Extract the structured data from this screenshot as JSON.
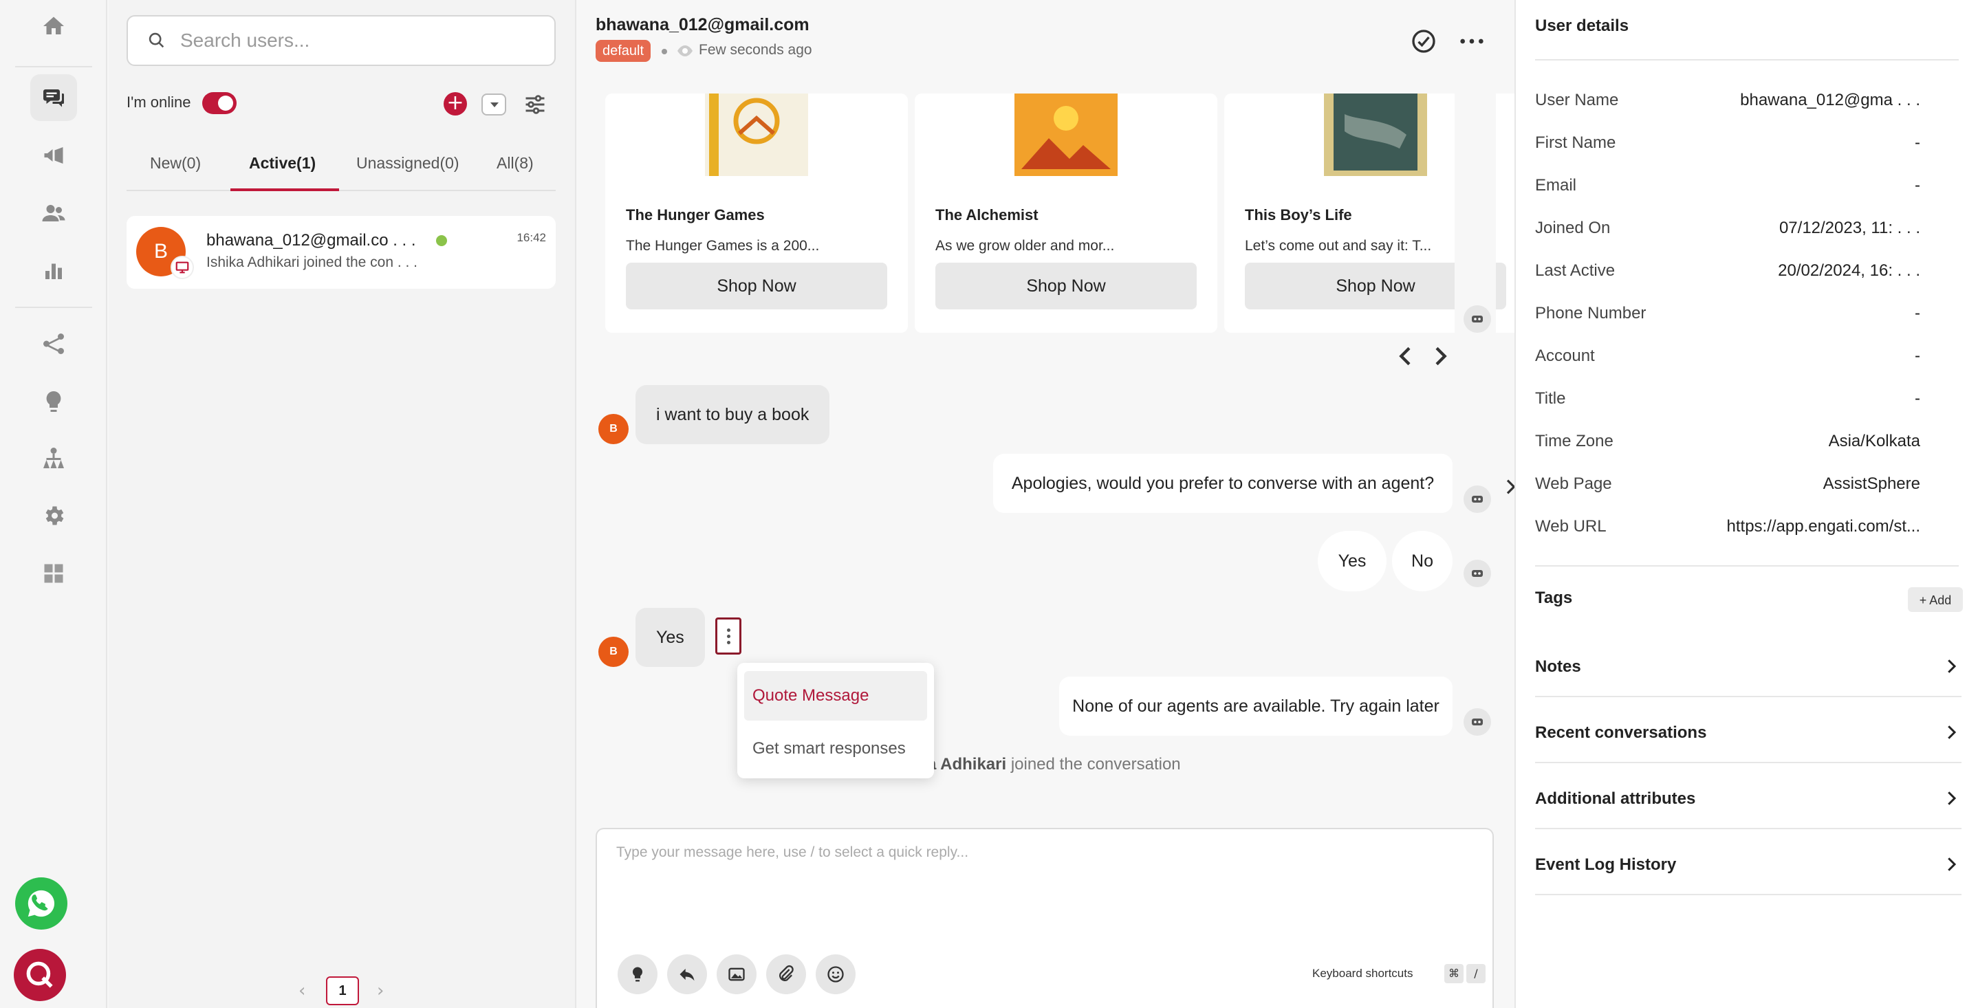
{
  "rail": {
    "icons": [
      "home-icon",
      "chat-icon",
      "megaphone-icon",
      "users-icon",
      "analytics-icon",
      "flow-icon",
      "bulb-icon",
      "org-chart-icon",
      "settings-icon",
      "integrations-icon"
    ],
    "active": "chat-icon"
  },
  "list": {
    "search_placeholder": "Search users...",
    "online_label": "I'm online",
    "tabs": [
      "New(0)",
      "Active(1)",
      "Unassigned(0)",
      "All(8)"
    ],
    "active_tab": "Active(1)",
    "conversation": {
      "avatar_letter": "B",
      "name": "bhawana_012@gmail.co . . .",
      "time": "16:42",
      "preview": "Ishika Adhikari joined the con . . .",
      "online_color": "#8bc34a"
    },
    "pager": {
      "page": "1",
      "prev": "‹",
      "next": "›"
    }
  },
  "chat": {
    "email": "bhawana_012@gmail.com",
    "badge": "default",
    "seen": "Few seconds ago",
    "cards": [
      {
        "title": "The Hunger Games",
        "desc": "The Hunger Games is a 200...",
        "button": "Shop Now"
      },
      {
        "title": "The Alchemist",
        "desc": "As we grow older and mor...",
        "button": "Shop Now"
      },
      {
        "title": "This Boy’s Life",
        "desc": "Let’s come out and say it: T...",
        "button": "Shop Now"
      }
    ],
    "messages": {
      "user_1": "i want to buy a book",
      "bot_1": "Apologies, would you prefer to converse with an agent?",
      "quick_yes": "Yes",
      "quick_no": "No",
      "user_2": "Yes",
      "bot_2": "None of our agents are available. Try again later",
      "user_avatar": "B"
    },
    "system_note_bold": "a Adhikari",
    "system_note": " joined the conversation",
    "context_menu": {
      "quote": "Quote Message",
      "smart": "Get smart responses"
    },
    "composer": {
      "placeholder": "Type your message here, use / to select a quick reply...",
      "shortcuts_label": "Keyboard shortcuts",
      "key1": "⌘",
      "key2": "/"
    }
  },
  "details": {
    "title": "User details",
    "rows": [
      {
        "label": "User Name",
        "value": "bhawana_012@gma . . ."
      },
      {
        "label": "First Name",
        "value": "-"
      },
      {
        "label": "Email",
        "value": "-"
      },
      {
        "label": "Joined On",
        "value": "07/12/2023, 11: . . ."
      },
      {
        "label": "Last Active",
        "value": "20/02/2024, 16: . . ."
      },
      {
        "label": "Phone Number",
        "value": "-"
      },
      {
        "label": "Account",
        "value": "-"
      },
      {
        "label": "Title",
        "value": "-"
      },
      {
        "label": "Time Zone",
        "value": "Asia/Kolkata"
      },
      {
        "label": "Web Page",
        "value": "AssistSphere"
      },
      {
        "label": "Web URL",
        "value": "https://app.engati.com/st..."
      }
    ],
    "tags_title": "Tags",
    "tags_add": "+ Add",
    "sections": [
      "Notes",
      "Recent conversations",
      "Additional attributes",
      "Event Log History"
    ]
  },
  "colors": {
    "accent": "#c0183a",
    "avatar": "#e85a16",
    "badge": "#e66a4f",
    "whatsapp": "#2dbd4f"
  }
}
